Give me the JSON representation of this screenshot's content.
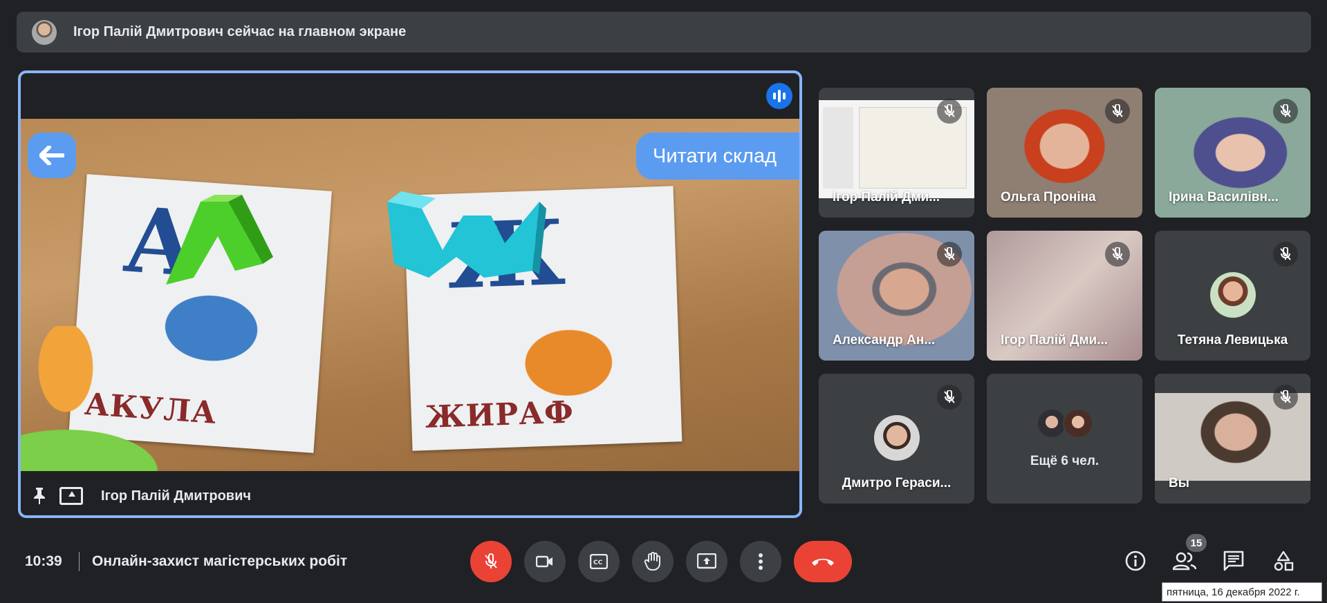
{
  "banner": {
    "text": "Ігор Палій Дмитрович сейчас на главном экране"
  },
  "main_tile": {
    "presenter_name": "Ігор Палій Дмитрович",
    "app_buttons": {
      "read_syllable": "Читати склад"
    },
    "cards": [
      {
        "word": "АКУЛА",
        "letter": "А"
      },
      {
        "word": "ЖИРАФ",
        "letter": "Ж"
      }
    ]
  },
  "participants": [
    {
      "name": "Ігор Палій Дми...",
      "muted": true
    },
    {
      "name": "Ольга Проніна",
      "muted": true
    },
    {
      "name": "Ірина Василівн...",
      "muted": true
    },
    {
      "name": "Александр Ан...",
      "muted": true
    },
    {
      "name": "Ігор Палій Дми...",
      "muted": true
    },
    {
      "name": "Тетяна Левицька",
      "muted": true
    },
    {
      "name": "Дмитро Гераси...",
      "muted": true
    },
    {
      "name": "Ещё 6 чел.",
      "muted": false
    },
    {
      "name": "Вы",
      "muted": true
    }
  ],
  "bottom_bar": {
    "time": "10:39",
    "meeting_title": "Онлайн-захист магістерських робіт",
    "participants_count": "15",
    "tooltip_date": "пятница, 16 декабря 2022 г."
  },
  "colors": {
    "background": "#202124",
    "tile": "#3c4043",
    "accent_blue": "#8ab4f8",
    "danger_red": "#ea4335"
  }
}
